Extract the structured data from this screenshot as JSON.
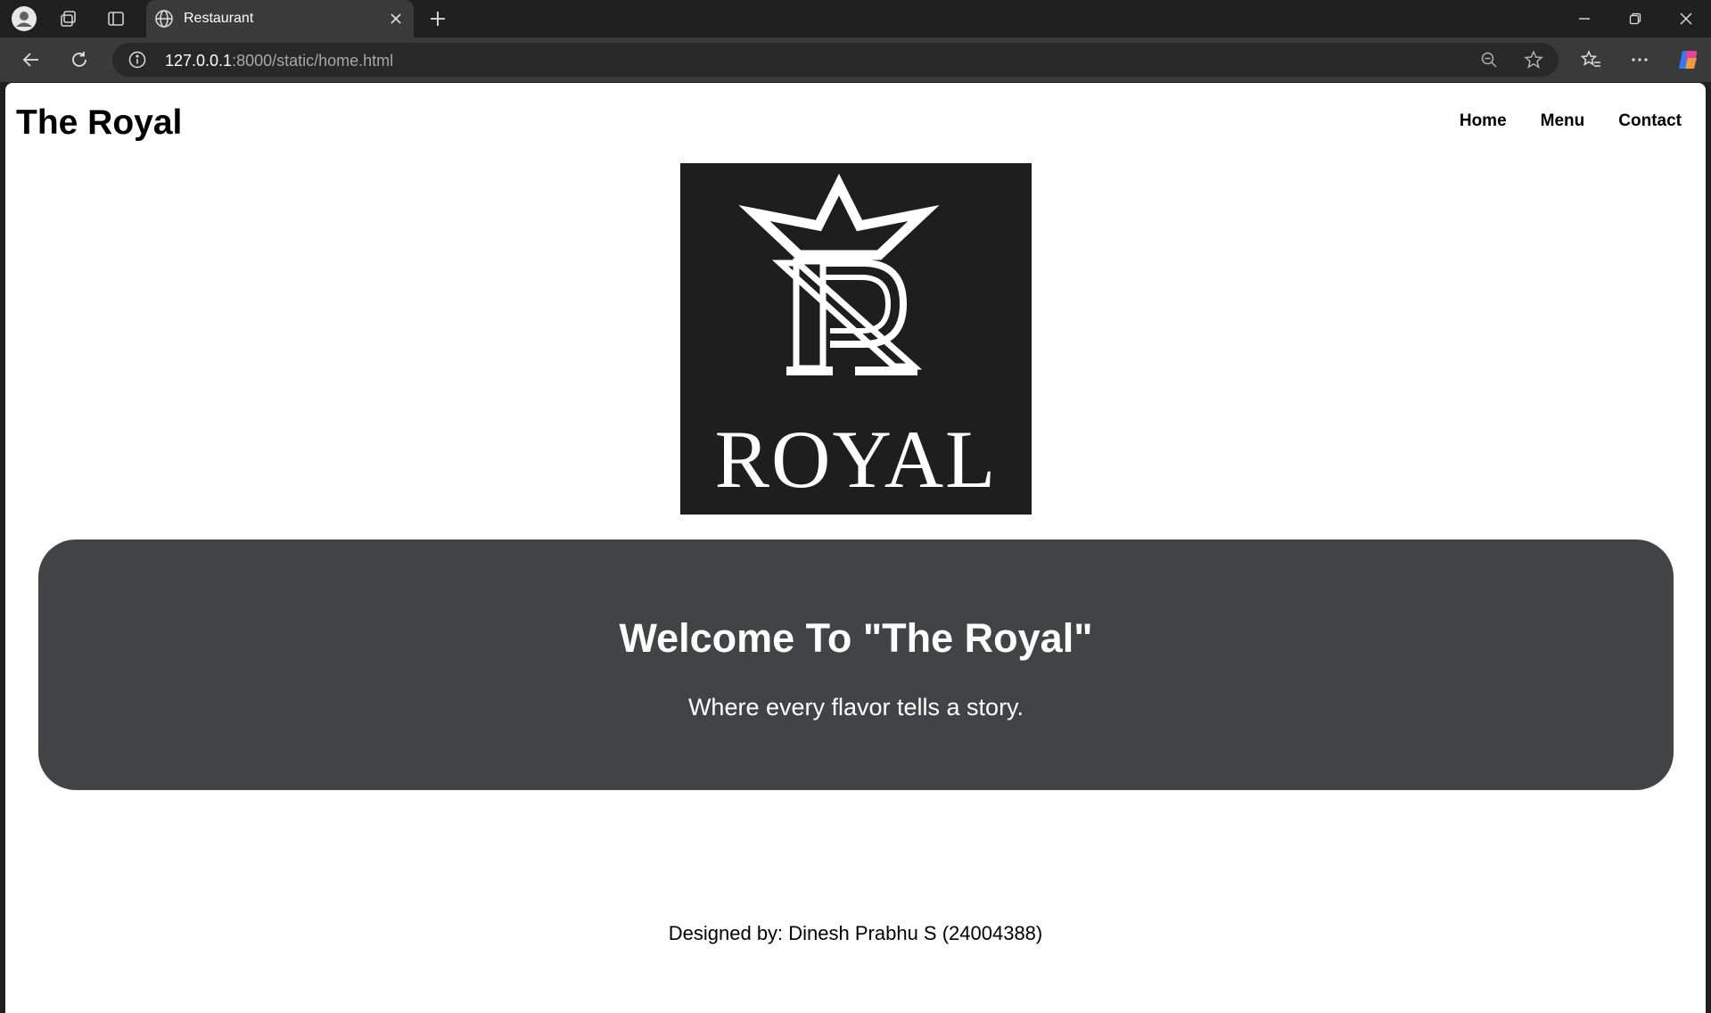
{
  "browser": {
    "tab_title": "Restaurant",
    "url_host": "127.0.0.1",
    "url_rest": ":8000/static/home.html",
    "icons": {
      "profile": "profile-icon",
      "workspaces": "workspaces-icon",
      "vertical_tabs": "vertical-tabs-icon",
      "favicon": "globe-icon",
      "tab_close": "close-icon",
      "new_tab": "plus-icon",
      "minimize": "minimize-icon",
      "restore": "restore-icon",
      "window_close": "close-icon",
      "back": "back-arrow-icon",
      "refresh": "refresh-icon",
      "site_info": "info-icon",
      "zoom": "zoom-out-icon",
      "favorite": "star-icon",
      "favorites": "favorites-icon",
      "more": "more-icon",
      "copilot": "copilot-icon"
    }
  },
  "site": {
    "brand": "The Royal",
    "nav": [
      {
        "label": "Home"
      },
      {
        "label": "Menu"
      },
      {
        "label": "Contact"
      }
    ],
    "logo_text": "ROYAL",
    "hero": {
      "title": "Welcome To \"The Royal\"",
      "subtitle": "Where every flavor tells a story."
    },
    "footer": "Designed by: Dinesh Prabhu S (24004388)"
  },
  "colors": {
    "hero_bg": "#424345",
    "logo_bg": "#1e1e1f",
    "chrome_bg": "#202020",
    "toolbar_bg": "#3a3a3a"
  }
}
